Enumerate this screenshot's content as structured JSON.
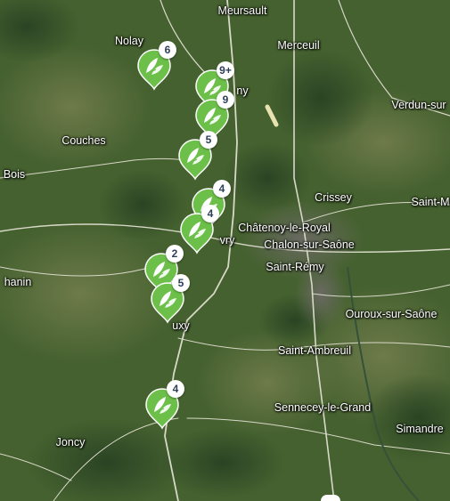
{
  "map": {
    "places": [
      {
        "id": "meursault",
        "name": "Meursault"
      },
      {
        "id": "nolay",
        "name": "Nolay"
      },
      {
        "id": "merceuil",
        "name": "Merceuil"
      },
      {
        "id": "verdun",
        "name": "Verdun-sur"
      },
      {
        "id": "ny",
        "name": "ny"
      },
      {
        "id": "couches",
        "name": "Couches"
      },
      {
        "id": "bois",
        "name": "Bois"
      },
      {
        "id": "crissey",
        "name": "Crissey"
      },
      {
        "id": "saint-m",
        "name": "Saint-M"
      },
      {
        "id": "chatenoy",
        "name": "Châtenoy-le-Royal"
      },
      {
        "id": "vry",
        "name": "vry"
      },
      {
        "id": "chalon",
        "name": "Chalon-sur-Saône"
      },
      {
        "id": "saint-remy",
        "name": "Saint-Rémy"
      },
      {
        "id": "chanin",
        "name": "hanin"
      },
      {
        "id": "ouroux",
        "name": "Ouroux-sur-Saône"
      },
      {
        "id": "buxy",
        "name": "uxy"
      },
      {
        "id": "saint-ambreuil",
        "name": "Saint-Ambreuil"
      },
      {
        "id": "sennecey",
        "name": "Sennecey-le-Grand"
      },
      {
        "id": "simandre",
        "name": "Simandre"
      },
      {
        "id": "joncy",
        "name": "Joncy"
      }
    ],
    "markers": [
      {
        "id": "m1",
        "count": "6"
      },
      {
        "id": "m2",
        "count": "9+"
      },
      {
        "id": "m3",
        "count": "9"
      },
      {
        "id": "m4",
        "count": "5"
      },
      {
        "id": "m5",
        "count": "4"
      },
      {
        "id": "m6",
        "count": "4"
      },
      {
        "id": "m7",
        "count": "2"
      },
      {
        "id": "m8",
        "count": "5"
      },
      {
        "id": "m9",
        "count": "4"
      }
    ],
    "colors": {
      "marker": "#6cc04a",
      "badge_text": "#2f3f58",
      "road": "#d8d8c8"
    },
    "icon": "vineyard-leaf-icon"
  }
}
